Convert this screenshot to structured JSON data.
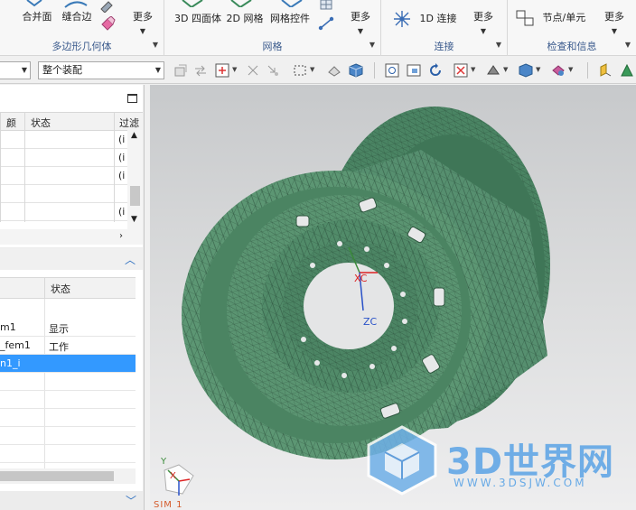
{
  "ribbon": {
    "polygon_group": {
      "title": "多边形几何体",
      "buttons": [
        {
          "label": "合并面",
          "icon": "merge-face-icon"
        },
        {
          "label": "缝合边",
          "icon": "stitch-edge-icon"
        },
        {
          "label": "更多",
          "icon": "more-icon"
        }
      ]
    },
    "mesh_group": {
      "title": "网格",
      "buttons": [
        {
          "label": "3D 四面体",
          "icon": "tetra-mesh-icon"
        },
        {
          "label": "2D 网格",
          "icon": "mesh-2d-icon"
        },
        {
          "label": "网格控件",
          "icon": "mesh-control-icon"
        },
        {
          "label": "更多",
          "icon": "more-icon"
        }
      ]
    },
    "connection_group": {
      "title": "连接",
      "buttons": [
        {
          "label": "1D 连接",
          "icon": "connection-1d-icon"
        },
        {
          "label": "更多",
          "icon": "more-icon"
        }
      ]
    },
    "check_group": {
      "title": "检查和信息",
      "buttons": [
        {
          "label": "节点/单元",
          "icon": "node-element-icon"
        },
        {
          "label": "更多",
          "icon": "more-icon"
        }
      ]
    }
  },
  "toolbar": {
    "scope_combo_value": "整个装配"
  },
  "upper_grid": {
    "columns": [
      "颜",
      "状态",
      "过滤"
    ],
    "rows": [
      {
        "filter": "(i"
      },
      {
        "filter": "(i"
      },
      {
        "filter": "(i"
      },
      {
        "filter": ""
      },
      {
        "filter": "(i"
      }
    ]
  },
  "lower_grid": {
    "columns": [
      "",
      "状态"
    ],
    "rows": [
      {
        "name": "m1",
        "status": "显示",
        "selected": false
      },
      {
        "name": "_fem1",
        "status": "工作",
        "selected": false
      },
      {
        "name": "n1_i",
        "status": "",
        "selected": true
      }
    ]
  },
  "viewport": {
    "triad_label_x": "XC",
    "triad_label_z": "ZC",
    "corner_triad_x": "X",
    "corner_triad_y": "Y",
    "coord_system_label": "SIM 1"
  },
  "watermark": {
    "brand": "3D世界网",
    "url": "WWW.3DSJW.COM"
  },
  "colors": {
    "selection": "#3399ff",
    "mesh_fill": "#4f8c69",
    "viewport_top": "#c7c9cb",
    "group_title": "#3a5a8c"
  }
}
